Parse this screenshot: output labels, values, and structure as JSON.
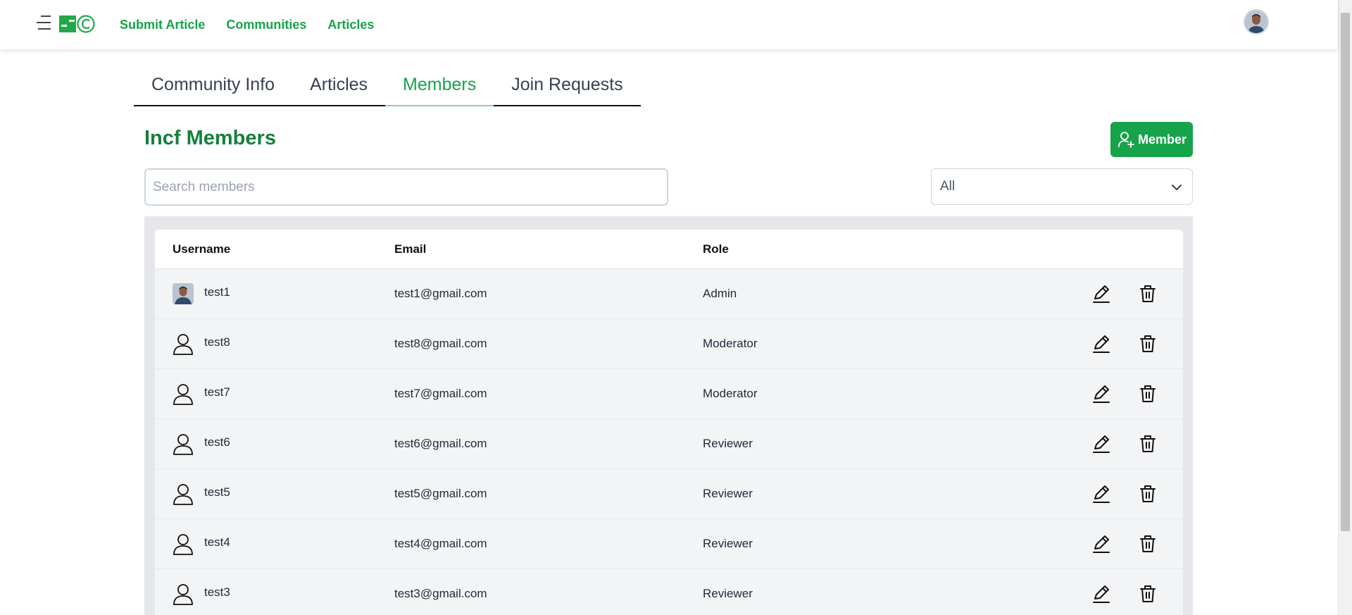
{
  "nav": {
    "links": [
      "Submit Article",
      "Communities",
      "Articles"
    ]
  },
  "tabs": [
    {
      "label": "Community Info",
      "active": false
    },
    {
      "label": "Articles",
      "active": false
    },
    {
      "label": "Members",
      "active": true
    },
    {
      "label": "Join Requests",
      "active": false
    }
  ],
  "page": {
    "title": "Incf Members",
    "add_label": "Member",
    "search_placeholder": "Search members",
    "search_value": "",
    "filter_value": "All"
  },
  "table": {
    "headers": {
      "username": "Username",
      "email": "Email",
      "role": "Role"
    },
    "rows": [
      {
        "username": "test1",
        "email": "test1@gmail.com",
        "role": "Admin",
        "avatar": "photo"
      },
      {
        "username": "test8",
        "email": "test8@gmail.com",
        "role": "Moderator",
        "avatar": "user-icon"
      },
      {
        "username": "test7",
        "email": "test7@gmail.com",
        "role": "Moderator",
        "avatar": "user-icon"
      },
      {
        "username": "test6",
        "email": "test6@gmail.com",
        "role": "Reviewer",
        "avatar": "user-icon"
      },
      {
        "username": "test5",
        "email": "test5@gmail.com",
        "role": "Reviewer",
        "avatar": "user-icon"
      },
      {
        "username": "test4",
        "email": "test4@gmail.com",
        "role": "Reviewer",
        "avatar": "user-icon"
      },
      {
        "username": "test3",
        "email": "test3@gmail.com",
        "role": "Reviewer",
        "avatar": "user-icon"
      }
    ]
  },
  "colors": {
    "accent": "#16a34a",
    "title": "#15803d"
  }
}
